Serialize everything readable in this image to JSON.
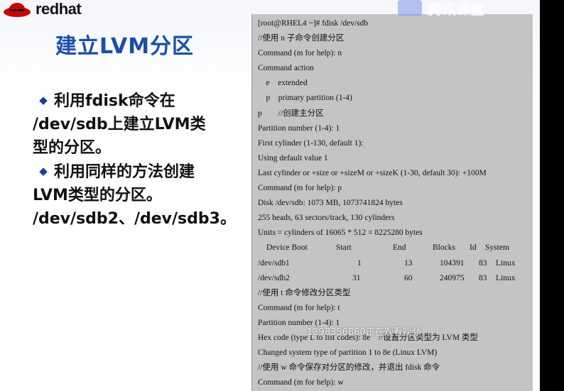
{
  "logo": {
    "brand": "redhat"
  },
  "slide": {
    "title": "建立LVM分区",
    "bullet1": {
      "line1": "利用fdisk命令在",
      "line2": "/dev/sdb上建立LVM类",
      "line3": "型的分区。"
    },
    "bullet2": {
      "line1": "利用同样的方法创建",
      "line2": "LVM类型的分区。",
      "line3": "/dev/sdb2、/dev/sdb3。"
    }
  },
  "terminal": {
    "lines": [
      "[root@RHEL4 ~]# fdisk /dev/sdb",
      "//使用 n 子命令创建分区",
      "Command (m for help): n",
      "Command action",
      "    e    extended",
      "    p    primary partition (1-4)",
      "p        //创建主分区",
      "Partition number (1-4): 1",
      "First cylinder (1-130, default 1):",
      "Using default value 1",
      "Last cylinder or +size or +sizeM or +sizeK (1-30, default 30): +100M",
      "Command (m for help): p",
      "Disk /dev/sdb: 1073 MB, 1073741824 bytes",
      "255 heads, 63 sectors/track, 130 cylinders",
      "Units = cylinders of 16065 * 512 = 8225280 bytes"
    ],
    "table": {
      "headers": [
        "Device Boot",
        "Start",
        "End",
        "Blocks",
        "Id",
        "System"
      ],
      "rows": [
        [
          "/dev/sdb1",
          "1",
          "13",
          "104391",
          "83",
          "Linux"
        ],
        [
          "/dev/sdb2",
          "31",
          "60",
          "240975",
          "83",
          "Linux"
        ]
      ]
    },
    "lines2": [
      "//使用 t 命令修改分区类型",
      "Command (m for help): t",
      "Partition number (1-4): 1",
      "Hex code (type L to list codes): 8e    //设置分区类型为 LVM 类型",
      "Changed system type of partition 1 to 8e (Linux LVM)",
      "//使用 w 命令保存对分区的修改，并退出 fdisk 命令",
      "Command (m for help): w"
    ]
  },
  "overlay": {
    "viewer_notice": "1298356860正在观看视频",
    "top_mark": "腾讯课堂"
  }
}
